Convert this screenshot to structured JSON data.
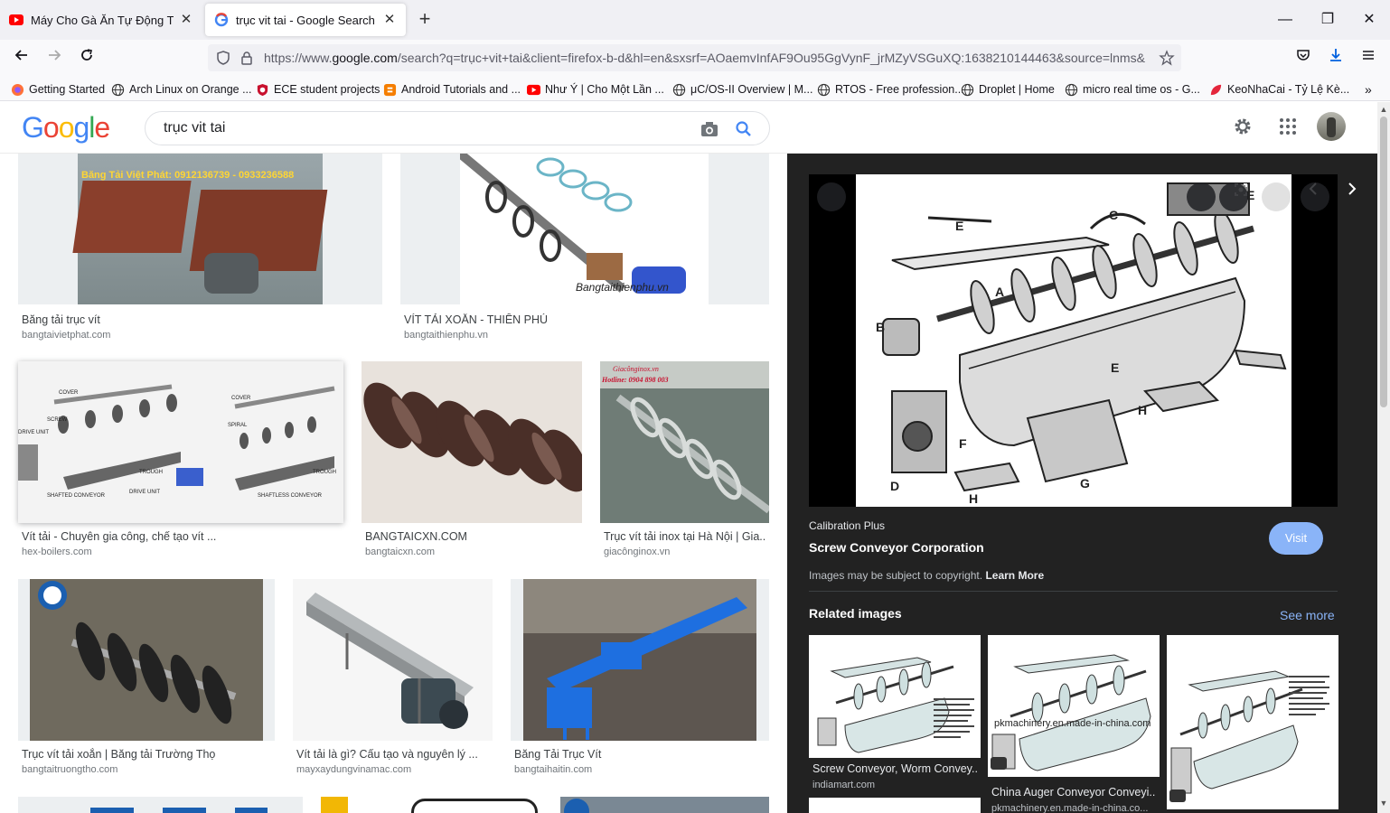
{
  "browser": {
    "tabs": [
      {
        "title": "Máy Cho Gà Ăn Tự Động Thông",
        "favicon": "youtube-icon"
      },
      {
        "title": "trục vit tai - Google Search",
        "favicon": "google-icon"
      }
    ],
    "url_prefix": "https://www.",
    "url_domain": "google.com",
    "url_rest": "/search?q=trục+vit+tai&client=firefox-b-d&hl=en&sxsrf=AOaemvInfAF9Ou95GgVynF_jrMZyVSGuXQ:1638210144463&source=lnms&",
    "bookmarks": [
      {
        "label": "Getting Started",
        "icon": "firefox-icon"
      },
      {
        "label": "Arch Linux on Orange ...",
        "icon": "globe-icon"
      },
      {
        "label": "ECE student projects",
        "icon": "shield-icon"
      },
      {
        "label": "Android Tutorials and ...",
        "icon": "blogger-icon"
      },
      {
        "label": "Như Ý | Cho Một Lần ...",
        "icon": "youtube-icon"
      },
      {
        "label": "μC/OS-II Overview | M...",
        "icon": "globe-icon"
      },
      {
        "label": "RTOS - Free profession...",
        "icon": "globe-icon"
      },
      {
        "label": "Droplet | Home",
        "icon": "globe-icon"
      },
      {
        "label": "micro real time os - G...",
        "icon": "globe-icon"
      },
      {
        "label": "KeoNhaCai - Tỷ Lệ Kè...",
        "icon": "leaf-icon"
      }
    ]
  },
  "google": {
    "logo": "Google",
    "query": "trục vit tai"
  },
  "results": [
    {
      "title": "Băng tải trục vít",
      "source": "bangtaivietphat.com",
      "overlay": "Băng Tải Việt Phát: 0912136739 - 0933236588"
    },
    {
      "title": "VÍT TẢI XOẮN - THIÊN PHÚ",
      "source": "bangtaithienphu.vn",
      "overlay": "Bangtaithienphu.vn"
    },
    {
      "title": "Vít tải - Chuyên gia công, chế tạo vít ...",
      "source": "hex-boilers.com",
      "labels": [
        "COVER",
        "SCREW",
        "DRIVE UNIT",
        "TROUGH",
        "DRIVE UNIT",
        "SHAFTED CONVEYOR",
        "COVER",
        "SPIRAL",
        "TROUGH",
        "SHAFTLESS CONVEYOR"
      ]
    },
    {
      "title": "BANGTAICXN.COM",
      "source": "bangtaicxn.com"
    },
    {
      "title": "Trục vít tải inox tại Hà Nội | Gia...",
      "source": "giacônginox.vn",
      "overlay1": "Giacônginox.vn",
      "overlay2": "Hotline: 0904 898 003"
    },
    {
      "title": "Trục vít tải xoắn | Băng tải Trường Thọ",
      "source": "bangtaitruongtho.com"
    },
    {
      "title": "Vít tải là gì? Cấu tạo và nguyên lý ...",
      "source": "mayxaydungvinamac.com"
    },
    {
      "title": "Băng Tải Trục Vít",
      "source": "bangtaihaitin.com"
    }
  ],
  "panel": {
    "source": "Calibration Plus",
    "title": "Screw Conveyor Corporation",
    "visit_label": "Visit",
    "copyright": "Images may be subject to copyright.",
    "learn_more": "Learn More",
    "related_title": "Related images",
    "see_more": "See more",
    "diagram_labels": [
      "A",
      "B",
      "C",
      "D",
      "E",
      "E",
      "E",
      "F",
      "G",
      "H",
      "H"
    ],
    "related": [
      {
        "title": "Screw Conveyor, Worm Convey...",
        "source": "indiamart.com"
      },
      {
        "title": "China Auger Conveyor Conveyi...",
        "source": "pkmachinery.en.made-in-china.co...",
        "watermark": "pkmachinery.en.made-in-china.com"
      },
      {
        "title": "",
        "source": ""
      }
    ]
  }
}
